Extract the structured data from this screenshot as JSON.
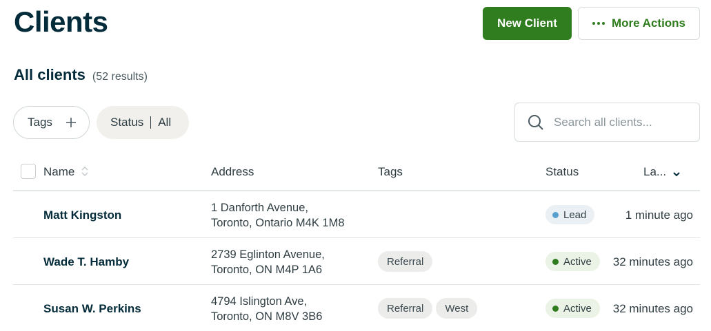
{
  "header": {
    "title": "Clients",
    "new_client_label": "New Client",
    "more_actions_label": "More Actions"
  },
  "list": {
    "heading": "All clients",
    "result_count": "(52 results)"
  },
  "filters": {
    "tags_label": "Tags",
    "status_label": "Status",
    "status_value": "All"
  },
  "search": {
    "placeholder": "Search all clients..."
  },
  "table": {
    "columns": {
      "name": "Name",
      "address": "Address",
      "tags": "Tags",
      "status": "Status",
      "last": "La..."
    },
    "rows": [
      {
        "name": "Matt Kingston",
        "address_line1": "1 Danforth Avenue,",
        "address_line2": "Toronto, Ontario M4K 1M8",
        "tags": [],
        "status": "Lead",
        "last_activity": "1 minute ago"
      },
      {
        "name": "Wade T. Hamby",
        "address_line1": "2739 Eglinton Avenue,",
        "address_line2": "Toronto, ON M4P 1A6",
        "tags": [
          "Referral"
        ],
        "status": "Active",
        "last_activity": "32 minutes ago"
      },
      {
        "name": "Susan W. Perkins",
        "address_line1": "4794 Islington Ave,",
        "address_line2": "Toronto, ON M8V 3B6",
        "tags": [
          "Referral",
          "West"
        ],
        "status": "Active",
        "last_activity": "32 minutes ago"
      }
    ]
  },
  "colors": {
    "primary": "#2f7d1e",
    "heading": "#032b3a",
    "lead_dot": "#5aa0cf",
    "active_dot": "#2f7d1e"
  },
  "icons": [
    "more-dots-icon",
    "plus-icon",
    "search-icon",
    "sort-icon",
    "chevron-down-icon"
  ]
}
